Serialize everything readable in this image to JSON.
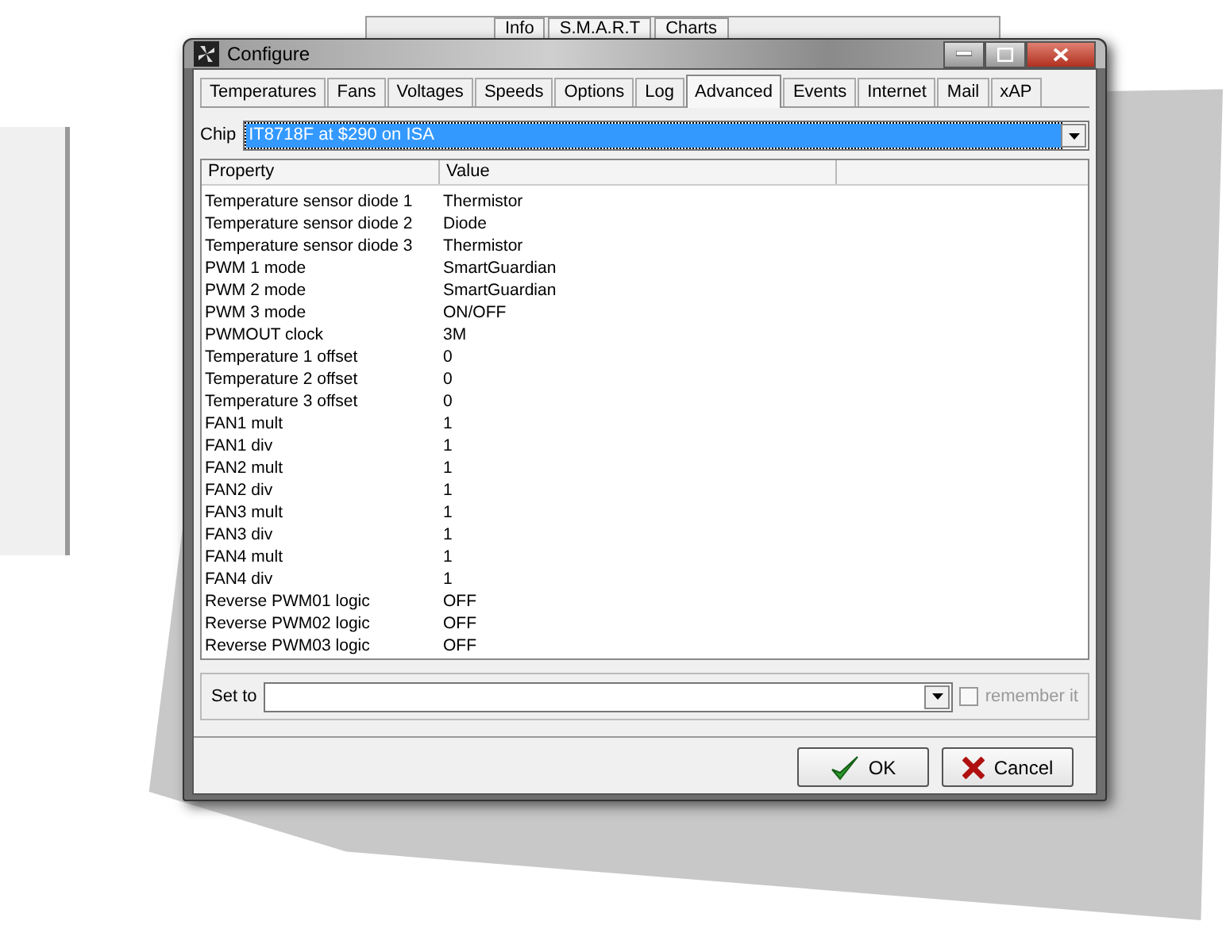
{
  "background_window": {
    "tabs": [
      "Info",
      "S.M.A.R.T",
      "Charts"
    ]
  },
  "window": {
    "title": "Configure"
  },
  "tabs": [
    {
      "label": "Temperatures",
      "selected": false
    },
    {
      "label": "Fans",
      "selected": false
    },
    {
      "label": "Voltages",
      "selected": false
    },
    {
      "label": "Speeds",
      "selected": false
    },
    {
      "label": "Options",
      "selected": false
    },
    {
      "label": "Log",
      "selected": false
    },
    {
      "label": "Advanced",
      "selected": true
    },
    {
      "label": "Events",
      "selected": false
    },
    {
      "label": "Internet",
      "selected": false
    },
    {
      "label": "Mail",
      "selected": false
    },
    {
      "label": "xAP",
      "selected": false
    }
  ],
  "chip": {
    "label": "Chip",
    "value": "IT8718F at $290 on ISA"
  },
  "table": {
    "columns": [
      "Property",
      "Value"
    ],
    "rows": [
      [
        "Temperature sensor diode 1",
        "Thermistor"
      ],
      [
        "Temperature sensor diode 2",
        "Diode"
      ],
      [
        "Temperature sensor diode 3",
        "Thermistor"
      ],
      [
        "PWM 1 mode",
        "SmartGuardian"
      ],
      [
        "PWM 2 mode",
        "SmartGuardian"
      ],
      [
        "PWM 3 mode",
        "ON/OFF"
      ],
      [
        "PWMOUT clock",
        "3M"
      ],
      [
        "Temperature 1 offset",
        "0"
      ],
      [
        "Temperature 2 offset",
        "0"
      ],
      [
        "Temperature 3 offset",
        "0"
      ],
      [
        "FAN1 mult",
        "1"
      ],
      [
        "FAN1 div",
        "1"
      ],
      [
        "FAN2 mult",
        "1"
      ],
      [
        "FAN2 div",
        "1"
      ],
      [
        "FAN3 mult",
        "1"
      ],
      [
        "FAN3 div",
        "1"
      ],
      [
        "FAN4 mult",
        "1"
      ],
      [
        "FAN4 div",
        "1"
      ],
      [
        "Reverse PWM01 logic",
        "OFF"
      ],
      [
        "Reverse PWM02 logic",
        "OFF"
      ],
      [
        "Reverse PWM03 logic",
        "OFF"
      ]
    ]
  },
  "set_to": {
    "label": "Set to",
    "remember": {
      "label": "remember it",
      "checked": false,
      "disabled": true
    }
  },
  "buttons": [
    {
      "label": "OK",
      "kind": "ok"
    },
    {
      "label": "Cancel",
      "kind": "cancel"
    }
  ]
}
